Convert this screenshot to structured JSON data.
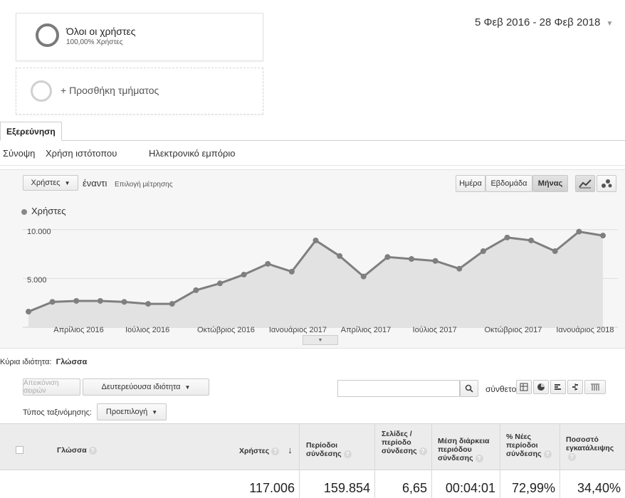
{
  "segments": {
    "all_users_title": "Όλοι οι χρήστες",
    "all_users_sub": "100,00% Χρήστες",
    "add_segment": "+ Προσθήκη τμήματος"
  },
  "date_range": "5 Φεβ 2016 - 28 Φεβ 2018",
  "tabs": {
    "explore": "Εξερεύνηση"
  },
  "subtabs": [
    "Σύνοψη",
    "Χρήση ιστότοπου",
    "Ηλεκτρονικό εμπόριο"
  ],
  "chart_controls": {
    "metric": "Χρήστες",
    "versus": "έναντι",
    "select_metric": "Επιλογή μέτρησης",
    "day": "Ημέρα",
    "week": "Εβδομάδα",
    "month": "Μήνας"
  },
  "chart_data": {
    "type": "area",
    "legend": [
      "Χρήστες"
    ],
    "y_ticks": [
      "10.000",
      "5.000"
    ],
    "ylim": [
      0,
      10500
    ],
    "x_tick_labels": [
      "Απρίλιος 2016",
      "Ιούλιος 2016",
      "Οκτώβριος 2016",
      "Ιανουάριος 2017",
      "Απρίλιος 2017",
      "Ιούλιος 2017",
      "Οκτώβριος 2017",
      "Ιανουάριος 2018"
    ],
    "x": [
      "Φεβ 2016",
      "Μαρ 2016",
      "Απρ 2016",
      "Μάι 2016",
      "Ιούν 2016",
      "Ιούλ 2016",
      "Αύγ 2016",
      "Σεπ 2016",
      "Οκτ 2016",
      "Νοέ 2016",
      "Δεκ 2016",
      "Ιαν 2017",
      "Φεβ 2017",
      "Μαρ 2017",
      "Απρ 2017",
      "Μάι 2017",
      "Ιούν 2017",
      "Ιούλ 2017",
      "Αύγ 2017",
      "Σεπ 2017",
      "Οκτ 2017",
      "Νοέ 2017",
      "Δεκ 2017",
      "Ιαν 2018",
      "Φεβ 2018"
    ],
    "series": [
      {
        "name": "Χρήστες",
        "values": [
          1600,
          2600,
          2700,
          2700,
          2600,
          2400,
          2400,
          3800,
          4500,
          5400,
          6500,
          5700,
          8900,
          7300,
          5200,
          7200,
          7000,
          6800,
          6000,
          7800,
          9200,
          8900,
          7800,
          9800,
          9400
        ]
      }
    ],
    "color": "#7f7f7f"
  },
  "dimension": {
    "label": "Κύρια ιδιότητα:",
    "value": "Γλώσσα",
    "plot_rows": "Απεικόνιση σειρών",
    "secondary": "Δευτερεύουσα ιδιότητα",
    "sort_type_label": "Τύπος ταξινόμησης:",
    "sort_type_value": "Προεπιλογή",
    "advanced": "σύνθετο",
    "search_placeholder": ""
  },
  "table": {
    "headers": {
      "language": "Γλώσσα",
      "users": "Χρήστες",
      "sessions": "Περίοδοι σύνδεσης",
      "pages_per_session": "Σελίδες / περίοδο σύνδεσης",
      "avg_duration": "Μέση διάρκεια περιόδου σύνδεσης",
      "new_sessions": "% Νέες περίοδοι σύνδεσης",
      "bounce_rate": "Ποσοστό εγκατάλειψης"
    },
    "totals": {
      "users": "117.006",
      "sessions": "159.854",
      "pages_per_session": "6,65",
      "avg_duration": "00:04:01",
      "new_sessions": "72,99%",
      "bounce_rate": "34,40%"
    }
  }
}
